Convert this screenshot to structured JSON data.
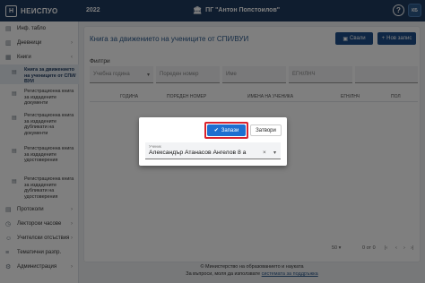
{
  "app": {
    "name": "НЕИСПУО",
    "logo_glyph": "Н",
    "year": "2022",
    "school": "ПГ \"Антон Попстоилов\"",
    "help_glyph": "?",
    "user_initials": "КБ",
    "accent_color": "#1e3a5f"
  },
  "sidebar": {
    "items": [
      {
        "label": "Инф. табло",
        "icon": "clipboard-icon"
      },
      {
        "label": "Дневници",
        "icon": "book-icon",
        "chevron": "›"
      },
      {
        "label": "Книги",
        "icon": "books-icon",
        "chevron": "‹"
      },
      {
        "label": "Протоколи",
        "icon": "document-icon",
        "chevron": "›"
      },
      {
        "label": "Лекторски часове",
        "icon": "clock-icon",
        "chevron": "›"
      },
      {
        "label": "Учителски отсъствия",
        "icon": "user-absent-icon",
        "chevron": "›"
      },
      {
        "label": "Тематични разпр.",
        "icon": "list-icon"
      },
      {
        "label": "Администрация",
        "icon": "gear-icon",
        "chevron": "›"
      }
    ],
    "sub_items": [
      {
        "label": "Книга за движението на учениците от СПИ/ВУИ",
        "active": true
      },
      {
        "label": "Регистрационна книга за издадените документи"
      },
      {
        "label": "Регистрационна книга за издадените дубликати на документи"
      },
      {
        "label": "Регистрационна книга за издадените удостоверения"
      },
      {
        "label": "Регистрационна книга за издадените дубликати на удостоверения"
      }
    ]
  },
  "main": {
    "title": "Книга за движението на учениците от СПИ/ВУИ",
    "save_label": "Свали",
    "new_label": "Нов запис",
    "filters_label": "Филтри",
    "filters": {
      "year_placeholder": "Учебна година",
      "ordinal_placeholder": "Пореден номер",
      "name_placeholder": "Име",
      "egn_placeholder": "ЕГН/ЛНЧ",
      "extra_placeholder": ""
    },
    "columns": [
      "Година",
      "Пореден номер",
      "Имена на ученика",
      "ЕГН/ЛНЧ",
      "Пол"
    ],
    "pager": {
      "per_page": "50",
      "range": "0 от 0"
    }
  },
  "footer": {
    "line1": "© Министерство на образованието и науката",
    "line2_prefix": "За въпроси, моля да използвате",
    "line2_link": "системата за поддръжка"
  },
  "dialog": {
    "save_label": "Запази",
    "close_label": "Затвори",
    "student_field_label": "Ученик",
    "student_field_value": "Александър Атанасов Ангелов 8 а",
    "clear_glyph": "×",
    "caret_glyph": "▾",
    "highlight_color": "#d9232d"
  }
}
